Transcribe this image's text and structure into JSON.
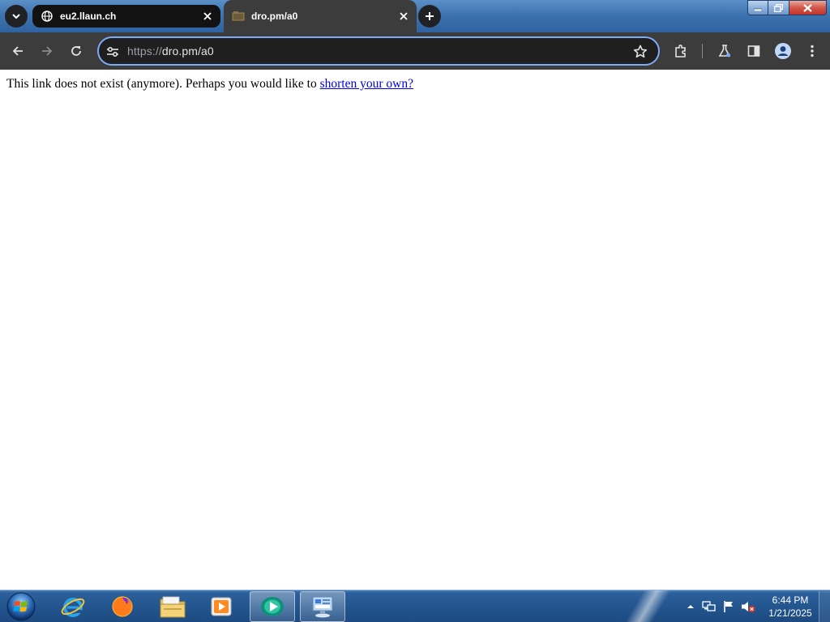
{
  "browser": {
    "tabs": [
      {
        "title": "eu2.llaun.ch",
        "active": false,
        "favicon": "globe-icon"
      },
      {
        "title": "dro.pm/a0",
        "active": true,
        "favicon": "page-favicon-icon"
      }
    ],
    "address_bar": {
      "scheme": "https://",
      "host_path": "dro.pm/a0"
    },
    "toolbar_icons": [
      "back-icon",
      "forward-icon",
      "reload-icon",
      "site-settings-icon",
      "bookmark-star-icon",
      "extensions-icon",
      "labs-icon",
      "side-panel-icon",
      "profile-icon",
      "menu-icon"
    ]
  },
  "page": {
    "message": "This link does not exist (anymore). Perhaps you would like to ",
    "link_text": "shorten your own?"
  },
  "taskbar": {
    "apps": [
      "internet-explorer-icon",
      "firefox-icon",
      "file-explorer-icon",
      "media-player-icon",
      "chrome-app-icon",
      "control-panel-icon"
    ],
    "tray_icons": [
      "show-hidden-icons",
      "network-icon",
      "action-center-flag-icon",
      "volume-muted-icon"
    ],
    "clock": {
      "time": "6:44 PM",
      "date": "1/21/2025"
    }
  }
}
